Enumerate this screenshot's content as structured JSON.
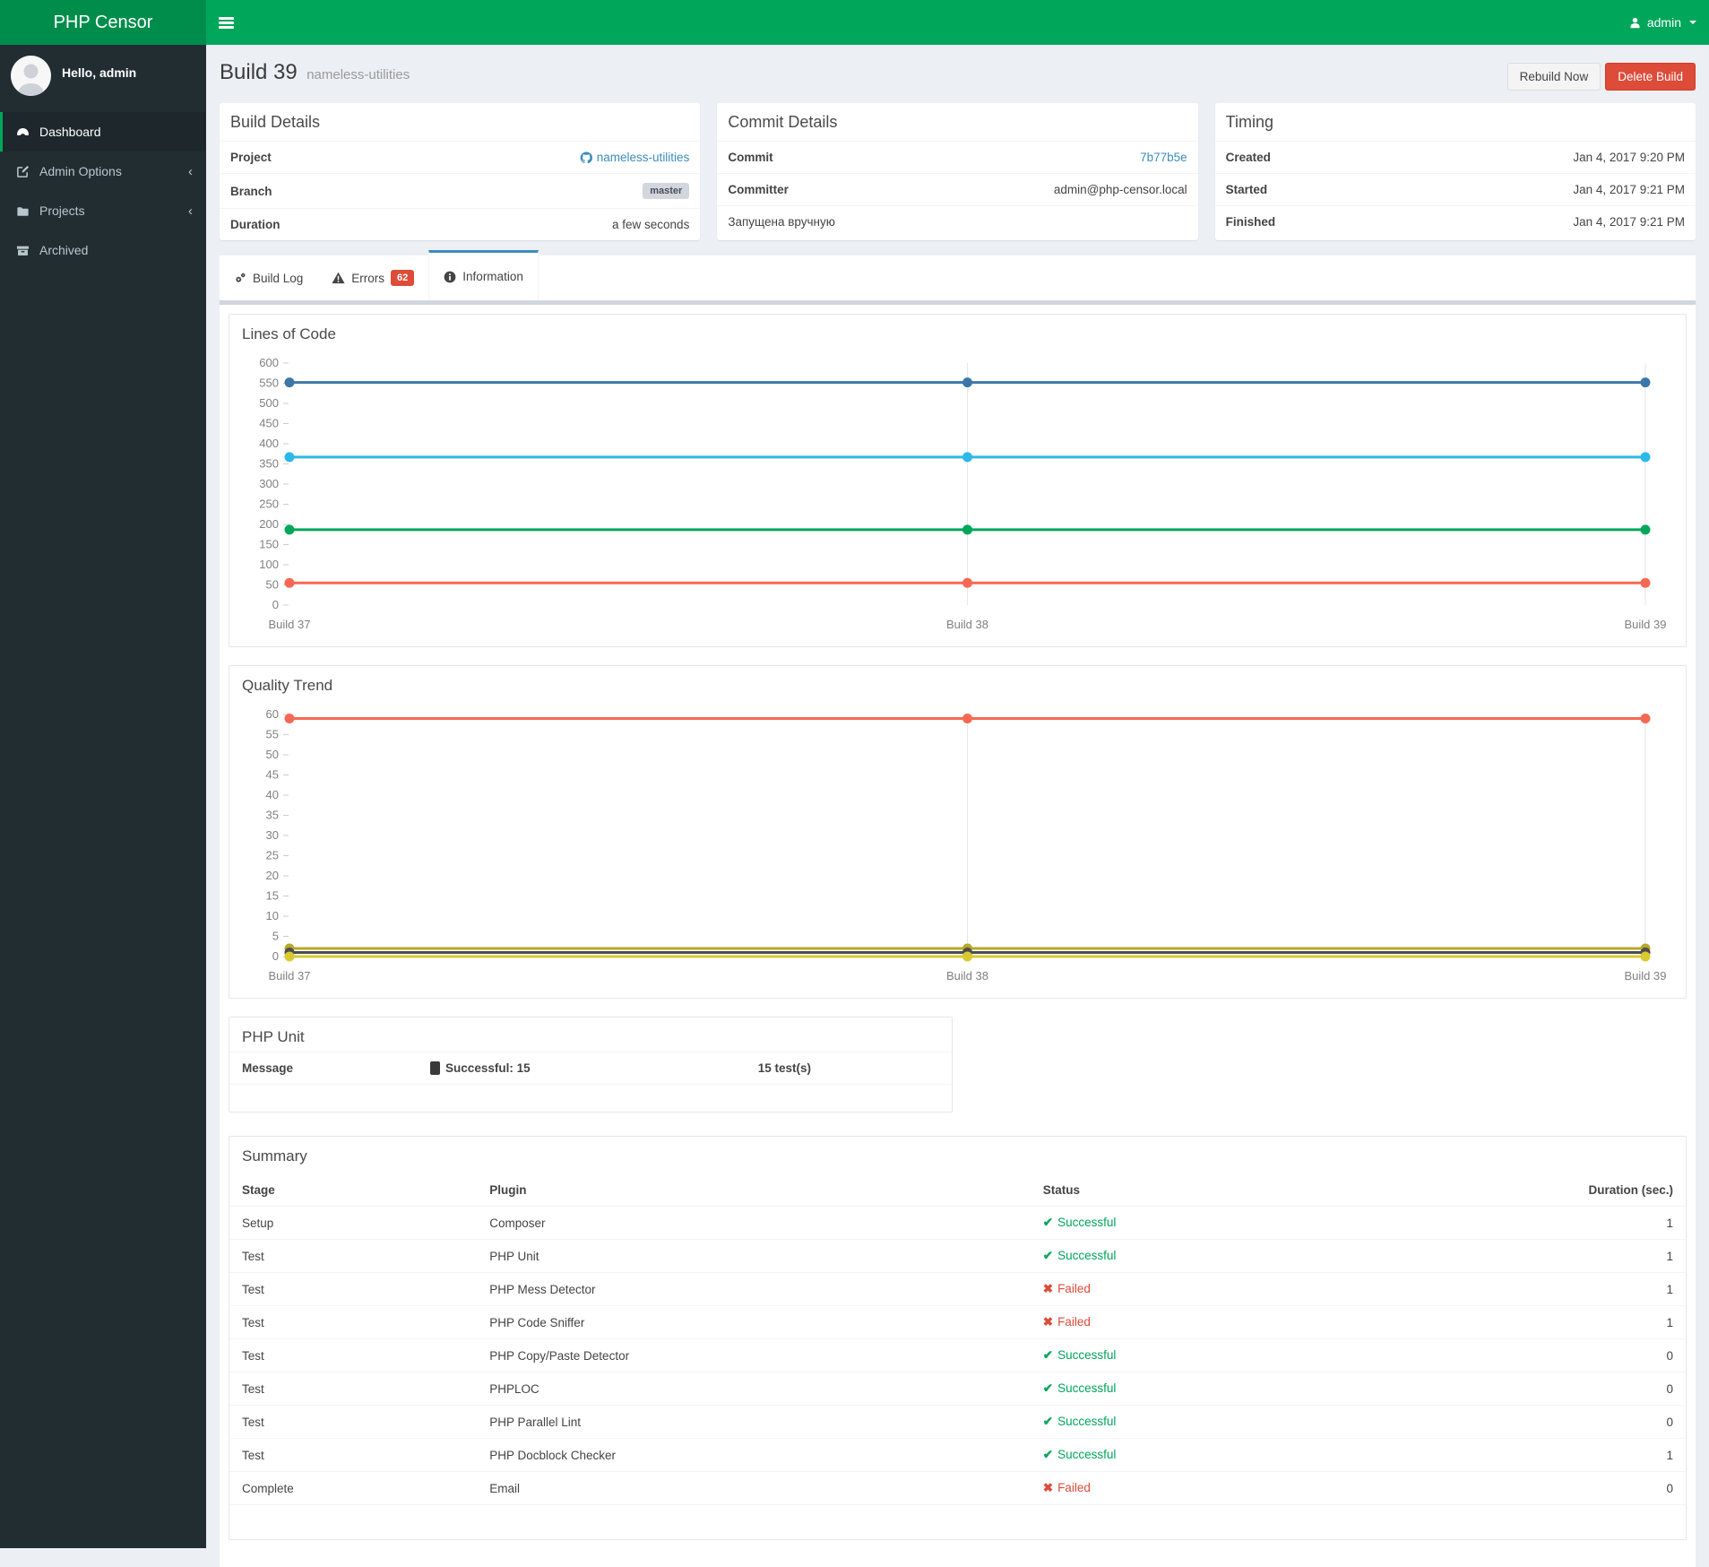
{
  "navbar": {
    "brand": "PHP Censor",
    "user_label": "admin"
  },
  "sidebar": {
    "greeting": "Hello, admin",
    "items": [
      {
        "label": "Dashboard",
        "active": true
      },
      {
        "label": "Admin Options",
        "chevron": "‹"
      },
      {
        "label": "Projects",
        "chevron": "‹"
      },
      {
        "label": "Archived"
      }
    ]
  },
  "header": {
    "title": "Build 39",
    "subtitle": "nameless-utilities",
    "rebuild_label": "Rebuild Now",
    "delete_label": "Delete Build"
  },
  "panels": {
    "build_details": {
      "title": "Build Details",
      "project_label": "Project",
      "project_value": "nameless-utilities",
      "branch_label": "Branch",
      "branch_value": "master",
      "duration_label": "Duration",
      "duration_value": "a few seconds"
    },
    "commit_details": {
      "title": "Commit Details",
      "commit_label": "Commit",
      "commit_value": "7b77b5e",
      "committer_label": "Committer",
      "committer_value": "admin@php-censor.local",
      "note": "Запущена вручную"
    },
    "timing": {
      "title": "Timing",
      "created_label": "Created",
      "created_value": "Jan 4, 2017 9:20 PM",
      "started_label": "Started",
      "started_value": "Jan 4, 2017 9:21 PM",
      "finished_label": "Finished",
      "finished_value": "Jan 4, 2017 9:21 PM"
    }
  },
  "tabs": [
    {
      "label": "Build Log"
    },
    {
      "label": "Errors",
      "badge": "62"
    },
    {
      "label": "Information",
      "active": true
    }
  ],
  "chart_data": [
    {
      "type": "line",
      "title": "Lines of Code",
      "categories": [
        "Build 37",
        "Build 38",
        "Build 39"
      ],
      "ylim": [
        0,
        600
      ],
      "ytick_step": 50,
      "legend": "none",
      "grid": "vertical-category-lines",
      "series": [
        {
          "name": "blue-line",
          "color": "#3d77a8",
          "values": [
            552,
            552,
            552
          ]
        },
        {
          "name": "aqua-line",
          "color": "#2cb8e8",
          "values": [
            367,
            367,
            367
          ]
        },
        {
          "name": "green-line",
          "color": "#00a65a",
          "values": [
            187,
            187,
            187
          ]
        },
        {
          "name": "red-line",
          "color": "#f56954",
          "values": [
            55,
            55,
            55
          ]
        }
      ]
    },
    {
      "type": "line",
      "title": "Quality Trend",
      "categories": [
        "Build 37",
        "Build 38",
        "Build 39"
      ],
      "ylim": [
        0,
        60
      ],
      "ytick_step": 5,
      "legend": "none",
      "grid": "vertical-category-lines",
      "series": [
        {
          "name": "red-line",
          "color": "#f56954",
          "values": [
            59,
            59,
            59
          ]
        },
        {
          "name": "olive-line",
          "color": "#b5a82b",
          "values": [
            2,
            2,
            2
          ]
        },
        {
          "name": "dark-gray-line",
          "color": "#4d4d4d",
          "values": [
            1,
            1,
            1
          ]
        },
        {
          "name": "yellow-line",
          "color": "#d9ca2f",
          "values": [
            0,
            0,
            0
          ]
        }
      ]
    }
  ],
  "php_unit": {
    "title": "PHP Unit",
    "message_header": "Message",
    "status_header": "Successful: 15",
    "tests_header": "15 test(s)"
  },
  "summary": {
    "title": "Summary",
    "columns": [
      "Stage",
      "Plugin",
      "Status",
      "Duration (sec.)"
    ],
    "rows": [
      {
        "stage": "Setup",
        "plugin": "Composer",
        "status": "Successful",
        "ok": true,
        "duration": "1"
      },
      {
        "stage": "Test",
        "plugin": "PHP Unit",
        "status": "Successful",
        "ok": true,
        "duration": "1"
      },
      {
        "stage": "Test",
        "plugin": "PHP Mess Detector",
        "status": "Failed",
        "ok": false,
        "duration": "1"
      },
      {
        "stage": "Test",
        "plugin": "PHP Code Sniffer",
        "status": "Failed",
        "ok": false,
        "duration": "1"
      },
      {
        "stage": "Test",
        "plugin": "PHP Copy/Paste Detector",
        "status": "Successful",
        "ok": true,
        "duration": "0"
      },
      {
        "stage": "Test",
        "plugin": "PHPLOC",
        "status": "Successful",
        "ok": true,
        "duration": "0"
      },
      {
        "stage": "Test",
        "plugin": "PHP Parallel Lint",
        "status": "Successful",
        "ok": true,
        "duration": "0"
      },
      {
        "stage": "Test",
        "plugin": "PHP Docblock Checker",
        "status": "Successful",
        "ok": true,
        "duration": "1"
      },
      {
        "stage": "Complete",
        "plugin": "Email",
        "status": "Failed",
        "ok": false,
        "duration": "0"
      }
    ]
  },
  "status_icons": {
    "success": "✔",
    "fail": "✖"
  },
  "colors": {
    "brand_green": "#00a65a",
    "logo_green": "#008d4c",
    "sidebar_bg": "#222d32",
    "link_blue": "#3c8dbc",
    "danger_red": "#dd4b39",
    "success_green": "#00a65a",
    "page_bg": "#ecf0f5",
    "active_tab_border": "#3c8dbc"
  }
}
